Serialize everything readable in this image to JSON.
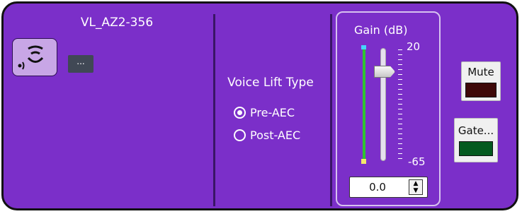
{
  "channel": {
    "name": "VL_AZ2-356",
    "more_label": "..."
  },
  "voice_lift": {
    "title": "Voice Lift Type",
    "options": [
      {
        "label": "Pre-AEC",
        "selected": true
      },
      {
        "label": "Post-AEC",
        "selected": false
      }
    ]
  },
  "gain": {
    "label": "Gain  (dB)",
    "max_label": "20",
    "min_label": "-65",
    "value": "0.0"
  },
  "buttons": {
    "mute_label": "Mute",
    "gate_label": "Gate...",
    "mute_led_color": "#3e0808",
    "gate_led_color": "#045a1f"
  },
  "colors": {
    "panel": "#7b2fc9",
    "meter": "#2fc430"
  }
}
